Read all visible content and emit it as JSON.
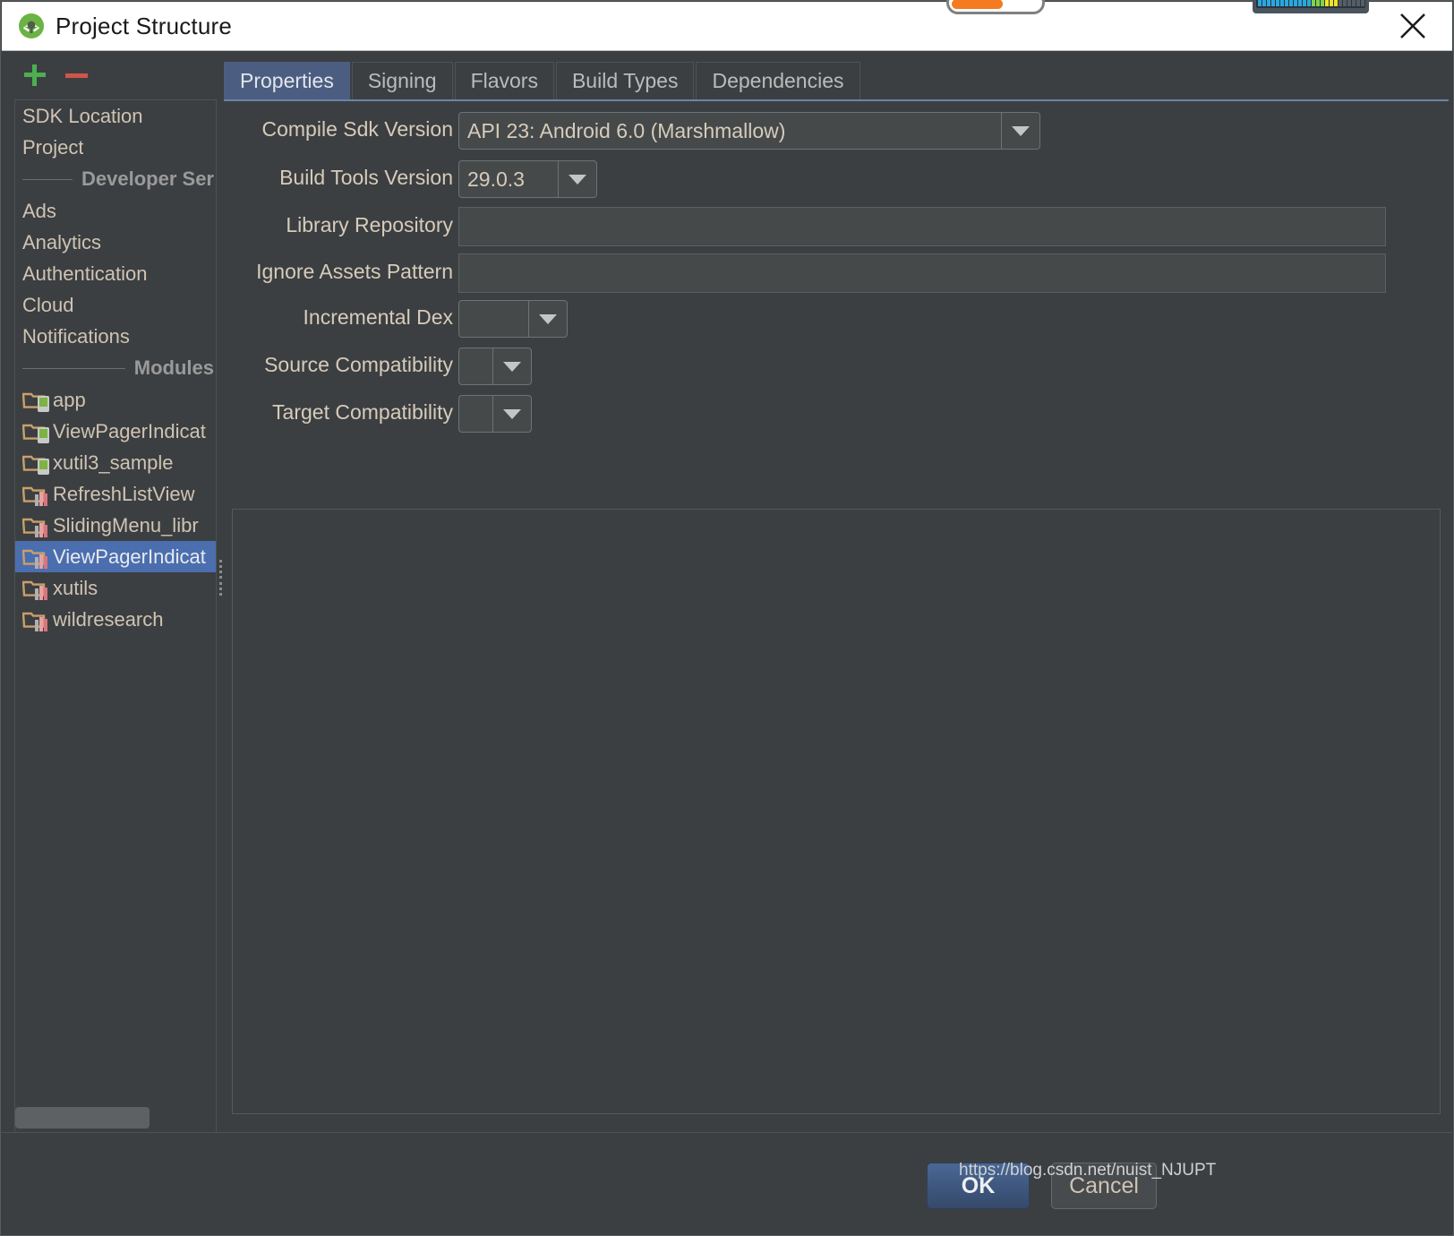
{
  "window": {
    "title": "Project Structure",
    "app_icon": "android-studio-icon",
    "close_label": "✕"
  },
  "titlebar_widgets": {
    "progress_pill": {
      "name": "progress-pill",
      "fill_color": "#f47b20",
      "percent": 55
    },
    "meter": {
      "name": "segment-meter-indicator",
      "active_segments": 18,
      "total_segments": 24
    }
  },
  "sidebar": {
    "toolbar": {
      "add_label": "+",
      "remove_label": "–"
    },
    "items": [
      {
        "label": "SDK Location",
        "type": "item",
        "icon": null,
        "selected": false
      },
      {
        "label": "Project",
        "type": "item",
        "icon": null,
        "selected": false
      },
      {
        "label": "Developer Ser",
        "type": "group"
      },
      {
        "label": "Ads",
        "type": "item",
        "icon": null,
        "selected": false
      },
      {
        "label": "Analytics",
        "type": "item",
        "icon": null,
        "selected": false
      },
      {
        "label": "Authentication",
        "type": "item",
        "icon": null,
        "selected": false
      },
      {
        "label": "Cloud",
        "type": "item",
        "icon": null,
        "selected": false
      },
      {
        "label": "Notifications",
        "type": "item",
        "icon": null,
        "selected": false
      },
      {
        "label": "Modules",
        "type": "group"
      },
      {
        "label": "app",
        "type": "module",
        "icon": "android-app-module-icon",
        "selected": false
      },
      {
        "label": "ViewPagerIndicat",
        "type": "module",
        "icon": "android-app-module-icon",
        "selected": false
      },
      {
        "label": "xutil3_sample",
        "type": "module",
        "icon": "android-app-module-icon",
        "selected": false
      },
      {
        "label": "RefreshListView",
        "type": "module",
        "icon": "android-library-module-icon",
        "selected": false
      },
      {
        "label": "SlidingMenu_libr",
        "type": "module",
        "icon": "android-library-module-icon",
        "selected": false
      },
      {
        "label": "ViewPagerIndicat",
        "type": "module",
        "icon": "android-library-module-icon",
        "selected": true
      },
      {
        "label": "xutils",
        "type": "module",
        "icon": "android-library-module-icon",
        "selected": false
      },
      {
        "label": "wildresearch",
        "type": "module",
        "icon": "android-library-module-icon",
        "selected": false
      }
    ],
    "selection_color": "#4b6eaf"
  },
  "main": {
    "tabs": [
      {
        "label": "Properties",
        "active": true
      },
      {
        "label": "Signing",
        "active": false
      },
      {
        "label": "Flavors",
        "active": false
      },
      {
        "label": "Build Types",
        "active": false
      },
      {
        "label": "Dependencies",
        "active": false
      }
    ],
    "fields": [
      {
        "label": "Compile Sdk Version",
        "value": "API 23: Android 6.0 (Marshmallow)",
        "control": "combobox"
      },
      {
        "label": "Build Tools Version",
        "value": "29.0.3",
        "control": "combobox"
      },
      {
        "label": "Library Repository",
        "value": "",
        "control": "textfield"
      },
      {
        "label": "Ignore Assets Pattern",
        "value": "",
        "control": "textfield"
      },
      {
        "label": "Incremental Dex",
        "value": "",
        "control": "combobox"
      },
      {
        "label": "Source Compatibility",
        "value": "",
        "control": "combobox"
      },
      {
        "label": "Target Compatibility",
        "value": "",
        "control": "combobox"
      }
    ]
  },
  "footer": {
    "ok_label": "OK",
    "cancel_label": "Cancel",
    "ok_color": "#3f5b86"
  },
  "watermark": {
    "text": "https://blog.csdn.net/nuist_NJUPT"
  }
}
